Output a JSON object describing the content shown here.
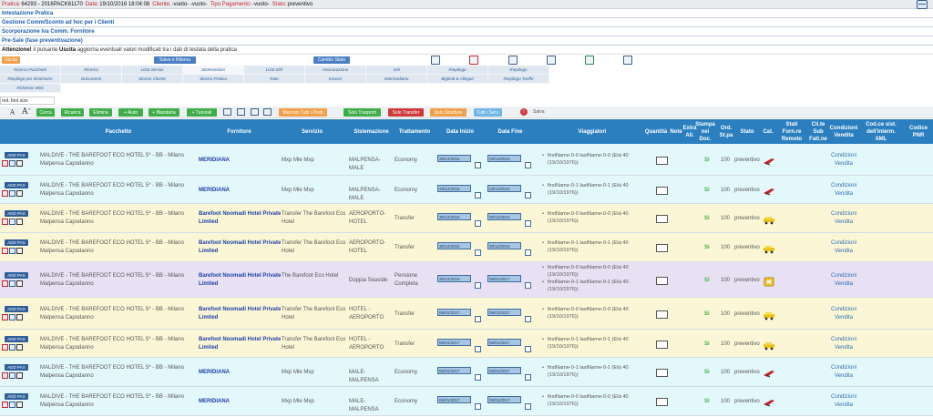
{
  "header": {
    "pratica_label": "Pratica:",
    "pratica_value": "64293 - 2016PACK61170",
    "data_label": "Data:",
    "data_value": "19/10/2016 18:04:08",
    "cliente_label": "Cliente:",
    "cliente_value": "-vuoto- -vuoto-",
    "tipo_label": "Tipo Pagamento:",
    "tipo_value": "-vuoto-",
    "stato_label": "Stato:",
    "stato_value": "preventivo"
  },
  "sections": [
    "Intestazione Pratica",
    "Gestione Comm/Sconto ad hoc per i Clienti",
    "Scorporazione Iva Comm. Fornitore",
    "Pre-Sale (fase preventivazione)"
  ],
  "attention": {
    "label": "Attenzione!",
    "text_before": " il pulsante ",
    "bold": "Uscita",
    "text_after": " aggiorna eventuali valori modificati tra i dati di testata della pratica"
  },
  "toolbar": {
    "uscita": "Uscita",
    "salva_ritorna": "Salva e Ritorna",
    "cambio_stato": "Cambio Stato"
  },
  "nav": {
    "row1": [
      "Ricerca Pacchetti",
      "Ricerca",
      "Lista Servizi",
      "Sistemazioni",
      "Lista S/R",
      "Assicurazione",
      "Voli",
      "Riepilogo",
      "Riepilogo"
    ],
    "row2": [
      "Riepilogo per destinione",
      "Documenti",
      "Storico Cliente",
      "Storico Pratica",
      "Rate",
      "Incassi",
      "Intermediario",
      "Biglietti & Allegati",
      "Riepilogo Tariffe"
    ],
    "row3": [
      "Richieste Web"
    ]
  },
  "font_size": "red. font size",
  "actions": {
    "cerca": "Cerca",
    "ricarica": "Ricarica",
    "elimina": "Elimina",
    "aiuta": "+ Aiuto",
    "biandaria": "+ Biandaria",
    "tutorial": "+ Tutoriali",
    "mercato": "Mercato Tutti i Posti",
    "trasporti": "Solo Trasporti",
    "transfer": "Solo Transfer",
    "strutture": "Solo Strutture",
    "tutti": "Tutti i Serv.",
    "salva": "Salva"
  },
  "columns": {
    "pacchetto": "Pacchetto",
    "fornitore": "Fornitore",
    "servizio": "Servizio",
    "sistemazione": "Sistemazione",
    "trattamento": "Trattamento",
    "data_inizio": "Data Inizio",
    "data_fine": "Data Fine",
    "viaggiatori": "Viaggiatori",
    "quantita": "Quantità",
    "note": "Note",
    "extra": "Extra All.",
    "stampa": "Stampa nei Doc.",
    "ord": "Ord. St.pa",
    "stato": "Stato",
    "cat": "Cat.",
    "stati_forn": "Stati Forn.re Remoto",
    "cli_te": "Cli.te Sub Fatt.ne",
    "condizioni": "Condizioni Vendita",
    "cod_ce": "Cod.ce sist. dell'interm. XML",
    "codice_pnr": "Codice PNR"
  },
  "add_pax": "ADD PAX",
  "rows": [
    {
      "color": "cyan",
      "pacchetto": "MALDIVE - THE BAREFOOT ECO HOTEL 5* - BB - Milano Malpensa Capodanno",
      "fornitore": "MERIDIANA",
      "servizio": "Mxp Mle Mxp",
      "sistemazione": "MALPENSA-MALE",
      "trattamento": "Economy",
      "di": "29/12/2016",
      "df": "29/12/2016",
      "viaggiatori": [
        "firstName-0-0 lastName-0-0 (Età 40 (19/10/1976))"
      ],
      "si": "Si",
      "ord": "100",
      "stato": "preventivo",
      "cat": "plane",
      "cond": "Condizioni Vendita"
    },
    {
      "color": "cyan",
      "pacchetto": "MALDIVE - THE BAREFOOT ECO HOTEL 5* - BB - Milano Malpensa Capodanno",
      "fornitore": "MERIDIANA",
      "servizio": "Mxp Mle Mxp",
      "sistemazione": "MALPENSA-MALE",
      "trattamento": "Economy",
      "di": "29/12/2016",
      "df": "29/12/2016",
      "viaggiatori": [
        "firstName-0-1 lastName-0-1 (Età 40 (19/10/1976))"
      ],
      "si": "Si",
      "ord": "100",
      "stato": "preventivo",
      "cat": "plane",
      "cond": "Condizioni Vendita"
    },
    {
      "color": "yellow",
      "pacchetto": "MALDIVE - THE BAREFOOT ECO HOTEL 5* - BB - Milano Malpensa Capodanno",
      "fornitore": "Barefoot Noomadi Hotel Private Limited",
      "servizio": "Transfer The Barefoot Eco Hotel",
      "sistemazione": "AEROPORTO-HOTEL",
      "trattamento": "Transfer",
      "di": "30/12/2016",
      "df": "30/12/2016",
      "viaggiatori": [
        "firstName-0-0 lastName-0-0 (Età 40 (19/10/1976))"
      ],
      "si": "Si",
      "ord": "100",
      "stato": "preventivo",
      "cat": "car",
      "cond": "Condizioni Vendita"
    },
    {
      "color": "yellow",
      "pacchetto": "MALDIVE - THE BAREFOOT ECO HOTEL 5* - BB - Milano Malpensa Capodanno",
      "fornitore": "Barefoot Noomadi Hotel Private Limited",
      "servizio": "Transfer The Barefoot Eco Hotel",
      "sistemazione": "AEROPORTO-HOTEL",
      "trattamento": "Transfer",
      "di": "30/12/2016",
      "df": "30/12/2016",
      "viaggiatori": [
        "firstName-0-1 lastName-0-1 (Età 40 (19/10/1976))"
      ],
      "si": "Si",
      "ord": "100",
      "stato": "preventivo",
      "cat": "car",
      "cond": "Condizioni Vendita"
    },
    {
      "color": "violet",
      "pacchetto": "MALDIVE - THE BAREFOOT ECO HOTEL 5* - BB - Milano Malpensa Capodanno",
      "fornitore": "Barefoot Noomadi Hotel Private Limited",
      "servizio": "The Barefoot Eco Hotel",
      "sistemazione": "Doppia Seaside",
      "trattamento": "Pensione Completa",
      "di": "30/12/2016",
      "df": "06/01/2017",
      "viaggiatori": [
        "firstName-0-0 lastName-0-0 (Età 40 (19/10/1976))",
        "firstName-0-1 lastName-0-1 (Età 40 (19/10/1976))"
      ],
      "si": "Si",
      "ord": "100",
      "stato": "preventivo",
      "cat": "hotel",
      "cond": "Condizioni Vendita"
    },
    {
      "color": "yellow",
      "pacchetto": "MALDIVE - THE BAREFOOT ECO HOTEL 5* - BB - Milano Malpensa Capodanno",
      "fornitore": "Barefoot Noomadi Hotel Private Limited",
      "servizio": "Transfer The Barefoot Eco Hotel",
      "sistemazione": "HOTEL - AEROPORTO",
      "trattamento": "Transfer",
      "di": "06/01/2017",
      "df": "06/01/2017",
      "viaggiatori": [
        "firstName-0-0 lastName-0-0 (Età 40 (19/10/1976))"
      ],
      "si": "Si",
      "ord": "100",
      "stato": "preventivo",
      "cat": "car",
      "cond": "Condizioni Vendita"
    },
    {
      "color": "yellow",
      "pacchetto": "MALDIVE - THE BAREFOOT ECO HOTEL 5* - BB - Milano Malpensa Capodanno",
      "fornitore": "Barefoot Noomadi Hotel Private Limited",
      "servizio": "Transfer The Barefoot Eco Hotel",
      "sistemazione": "HOTEL - AEROPORTO",
      "trattamento": "Transfer",
      "di": "06/01/2017",
      "df": "06/01/2017",
      "viaggiatori": [
        "firstName-0-1 lastName-0-1 (Età 40 (19/10/1976))"
      ],
      "si": "Si",
      "ord": "100",
      "stato": "preventivo",
      "cat": "car",
      "cond": "Condizioni Vendita"
    },
    {
      "color": "cyan",
      "pacchetto": "MALDIVE - THE BAREFOOT ECO HOTEL 5* - BB - Milano Malpensa Capodanno",
      "fornitore": "MERIDIANA",
      "servizio": "Mxp Mle Mxp",
      "sistemazione": "MALE-MALPENSA",
      "trattamento": "Economy",
      "di": "06/01/2017",
      "df": "06/01/2017",
      "viaggiatori": [
        "firstName-0-1 lastName-0-1 (Età 40 (19/10/1976))"
      ],
      "si": "Si",
      "ord": "100",
      "stato": "preventivo",
      "cat": "plane",
      "cond": "Condizioni Vendita"
    },
    {
      "color": "cyan",
      "pacchetto": "MALDIVE - THE BAREFOOT ECO HOTEL 5* - BB - Milano Malpensa Capodanno",
      "fornitore": "MERIDIANA",
      "servizio": "Mxp Mle Mxp",
      "sistemazione": "MALE-MALPENSA",
      "trattamento": "Economy",
      "di": "06/01/2017",
      "df": "06/01/2017",
      "viaggiatori": [
        "firstName-0-0 lastName-0-0 (Età 40 (19/10/1976))"
      ],
      "si": "Si",
      "ord": "100",
      "stato": "preventivo",
      "cat": "plane",
      "cond": "Condizioni Vendita"
    }
  ]
}
